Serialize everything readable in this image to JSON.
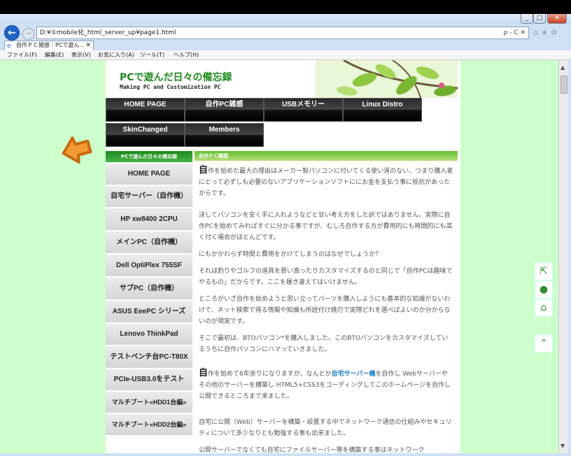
{
  "browser": {
    "address": "D:¥①mobile化_html_server_up¥page1.html",
    "address_icons": "ρ - C ✕",
    "tab_title": "自作ＰＣ雑感｜PCで遊ん...",
    "menu": [
      "ファイル(F)",
      "編集(E)",
      "表示(V)",
      "お気に入り(A)",
      "ツール(T)",
      "ヘルプ(H)"
    ]
  },
  "site": {
    "title": "PCで遊んだ日々の備忘録",
    "subtitle": "Making PC and Customization PC",
    "nav": [
      "HOME PAGE",
      "自作PC雑感",
      "USBメモリー",
      "Linux Distro",
      "SkinChanged",
      "Members"
    ]
  },
  "sidebar": {
    "heading": "PCで遊んだ日々の備忘録",
    "items": [
      "HOME PAGE",
      "自宅サーバー（自作機）",
      "HP xw8400 2CPU",
      "メインPC（自作機）",
      "Dell OptiPlex 755SF",
      "サブPC（自作機）",
      "ASUS EeePC シリーズ",
      "Lenovo ThinkPad",
      "テストベンチ台PC-T80X",
      "PCIe-USB3.0をテスト",
      "マルチブート«HDD1台編»",
      "マルチブート«HDD2台編»"
    ]
  },
  "main": {
    "heading": "自作ＰＣ雑感",
    "p1_cap": "自",
    "p1": "作を始めた最大の理由はメーカー製パソコンに付いてくる使い道のない、つまり購入者にとって必ずしも必要のないアプリケーションソフトににお金を支払う事に抵抗があったからです。",
    "p2": "決してパソコンを安く手に入れようなどと甘い考え方をした訳ではありません。実際に自作PCを始めてみればすぐに分かる事ですが、むしろ自作する方が費用的にも時間的にも高く付く場合がほとんどです。",
    "p3": "にもかかわらず時間と費用をかけてしまうのはなぜでしょうか？",
    "p4": "それは釣りやゴルフの道具を買い漁ったりカスタマイズするのと同じで「自作PCは趣味でやるもの」だからです。ここを履き違えてはいけません。",
    "p5": "ところがいざ自作を始めようと思い立ってパーツを購入しようにも基本的な知識がないわけで、ネット検索で得る情報や知識も所詮付け焼刃で実際どれを選べばよいのか分からないのが現実です。",
    "p6": "そこで最初は、BTOパソコン*を購入しました。このBTOパソコンをカスタマイズしているうちに自作パソコンにハマっていきました。",
    "p7_cap": "自",
    "p7a": "作を始めて6年余りになりますが、なんとか",
    "p7_link": "自宅サーバー機",
    "p7b": "を自作し Webサーバーやその他のサーバーを構築し HTML5+CSS3をコーディングしてこのホームページを自作し公開できるところまで来ました。",
    "p8": "自宅に公開（Web）サーバーを構築・設置する中でネットワーク通信の仕組みやセキュリティについて多少なりとも勉強する事も出来ました。",
    "p9": "公開サーバーでなくても自宅にファイルサーバー等を構築する事はネットワーク"
  },
  "colors": {
    "page_bg": "#ccffcc",
    "title_green": "#1e8a1e",
    "link": "#1b7fc4"
  },
  "icons": {
    "share": "share-icon",
    "user": "user-icon",
    "home": "home-icon",
    "up": "chevron-up-icon"
  }
}
